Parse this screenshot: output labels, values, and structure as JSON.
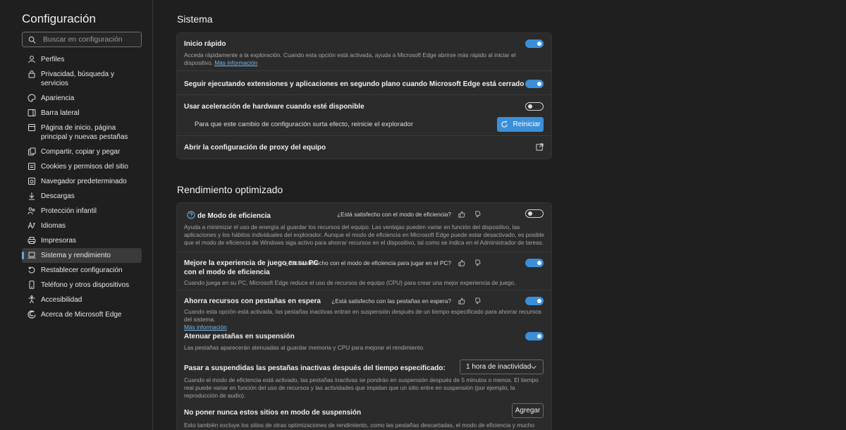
{
  "sidebar": {
    "title": "Configuración",
    "search_placeholder": "Buscar en configuración",
    "items": [
      {
        "label": "Perfiles",
        "icon": "person-icon"
      },
      {
        "label": "Privacidad, búsqueda y servicios",
        "icon": "lock-icon"
      },
      {
        "label": "Apariencia",
        "icon": "palette-icon"
      },
      {
        "label": "Barra lateral",
        "icon": "sidebar-icon"
      },
      {
        "label": "Página de inicio, página principal y nuevas pestañas",
        "icon": "home-icon"
      },
      {
        "label": "Compartir, copiar y pegar",
        "icon": "share-icon"
      },
      {
        "label": "Cookies y permisos del sitio",
        "icon": "site-permissions-icon"
      },
      {
        "label": "Navegador predeterminado",
        "icon": "browser-icon"
      },
      {
        "label": "Descargas",
        "icon": "download-icon"
      },
      {
        "label": "Protección infantil",
        "icon": "family-icon"
      },
      {
        "label": "Idiomas",
        "icon": "language-icon"
      },
      {
        "label": "Impresoras",
        "icon": "printer-icon"
      },
      {
        "label": "Sistema y rendimiento",
        "icon": "laptop-icon",
        "active": true
      },
      {
        "label": "Restablecer configuración",
        "icon": "reset-icon"
      },
      {
        "label": "Teléfono y otros dispositivos",
        "icon": "phone-icon"
      },
      {
        "label": "Accesibilidad",
        "icon": "accessibility-icon"
      },
      {
        "label": "Acerca de Microsoft Edge",
        "icon": "edge-icon"
      }
    ]
  },
  "sistema": {
    "title": "Sistema",
    "inicio_rapido": {
      "title": "Inicio rápido",
      "desc": "Acceda rápidamente a la exploración. Cuando esta opción está activada, ayuda a Microsoft Edge abrirse más rápido al iniciar el dispositivo.",
      "link": "Más información",
      "enabled": true
    },
    "extensiones": {
      "title": "Seguir ejecutando extensiones y aplicaciones en segundo plano cuando Microsoft Edge está cerrado",
      "enabled": true
    },
    "aceleracion": {
      "title": "Usar aceleración de hardware cuando esté disponible",
      "enabled": false,
      "restart_msg": "Para que este cambio de configuración surta efecto, reinicie el explorador",
      "restart_button": "Reiniciar"
    },
    "proxy": {
      "title": "Abrir la configuración de proxy del equipo"
    }
  },
  "rendimiento": {
    "title": "Rendimiento optimizado",
    "eficiencia": {
      "title": "de Modo de eficiencia",
      "feedback": "¿Está satisfecho con el modo de eficiencia?",
      "desc": "Ayuda a minimizar el uso de energía al guardar los recursos del equipo. Las ventajas pueden variar en función del dispositivo, las aplicaciones y los hábitos individuales del explorador. Aunque el modo de eficiencia en Microsoft Edge puede estar desactivado, es posible que el modo de eficiencia de Windows siga activo para ahorrar recursos en el dispositivo, tal como se indica en el Administrador de tareas.",
      "enabled": false
    },
    "juego": {
      "title": "Mejore la experiencia de juego en su PC con el modo de eficiencia",
      "feedback": "¿Está satisfecho con el modo de eficiencia para jugar en el PC?",
      "desc": "Cuando juega en su PC, Microsoft Edge reduce el uso de recursos de equipo (CPU) para crear una mejor experiencia de juego.",
      "enabled": true
    },
    "pestanas": {
      "title": "Ahorra recursos con pestañas en espera",
      "feedback": "¿Está satisfecho con las pestañas en espera?",
      "desc": "Cuando esta opción está activada, las pestañas inactivas entran en suspensión después de un tiempo especificado para ahorrar recursos del sistema.",
      "link": "Más información",
      "enabled": true
    },
    "atenuar": {
      "title": "Atenuar pestañas en suspensión",
      "desc": "Las pestañas aparecerán atenuadas al guardar memoria y CPU para mejorar el rendimiento.",
      "enabled": true
    },
    "suspender": {
      "title": "Pasar a suspendidas las pestañas inactivas después del tiempo especificado:",
      "selected": "1 hora de inactividad",
      "desc": "Cuando el modo de eficiencia está activado, las pestañas inactivas se pondrán en suspensión después de 5 minutos o menos. El tiempo real puede variar en función del uso de recursos y las actividades que impidan que un sitio entre en suspensión (por ejemplo, la reproducción de audio)."
    },
    "nunca": {
      "title": "No poner nunca estos sitios en modo de suspensión",
      "add_button": "Agregar",
      "desc": "Esto también excluye los sitios de otras optimizaciones de rendimiento, como las pestañas descartadas, el modo de eficiencia y mucho más."
    }
  },
  "colors": {
    "accent": "#3b8fd9",
    "link": "#76b9ed",
    "card": "#2b2b2b",
    "background": "#1f1f1f"
  }
}
